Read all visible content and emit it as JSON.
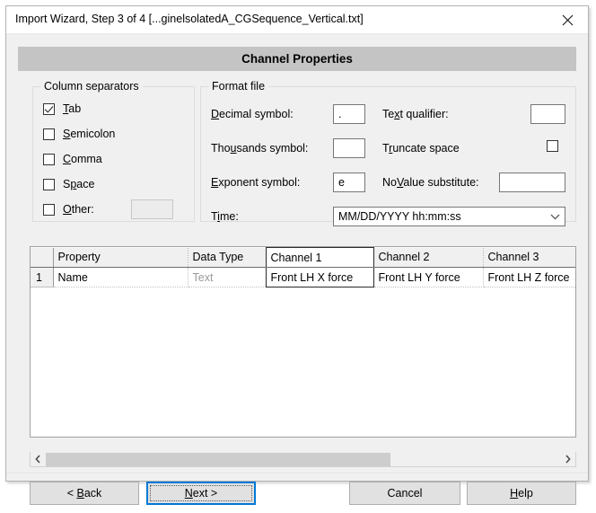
{
  "window": {
    "title": "Import Wizard, Step 3 of 4 [...ginelsolatedA_CGSequence_Vertical.txt]",
    "close_icon": "close-icon"
  },
  "banner": {
    "title": "Channel Properties"
  },
  "column_separators": {
    "group_title": "Column separators",
    "items": [
      {
        "label": "Tab",
        "accel": "T",
        "checked": true
      },
      {
        "label": "Semicolon",
        "accel": "S",
        "checked": false
      },
      {
        "label": "Comma",
        "accel": "C",
        "checked": false
      },
      {
        "label": "Space",
        "accel": "p",
        "checked": false
      },
      {
        "label": "Other:",
        "accel": "O",
        "checked": false
      }
    ],
    "other_value": "",
    "other_enabled": false
  },
  "format_file": {
    "group_title": "Format file",
    "decimal_symbol": {
      "label": "Decimal symbol:",
      "accel": "D",
      "value": "."
    },
    "thousands_symbol": {
      "label": "Thousands symbol:",
      "accel": "u",
      "value": ""
    },
    "exponent_symbol": {
      "label": "Exponent symbol:",
      "accel": "E",
      "value": "e"
    },
    "text_qualifier": {
      "label": "Text qualifier:",
      "accel": "x",
      "value": ""
    },
    "truncate_space": {
      "label": "Truncate space",
      "accel": "r",
      "checked": false
    },
    "novalue_substitute": {
      "label": "NoValue substitute:",
      "accel": "V",
      "value": ""
    },
    "time": {
      "label": "Time:",
      "accel": "i",
      "value": "MM/DD/YYYY hh:mm:ss",
      "arrow_icon": "chevron-down-icon"
    }
  },
  "table": {
    "headers": [
      "",
      "Property",
      "Data Type",
      "Channel 1",
      "Channel 2",
      "Channel 3"
    ],
    "selected_column_index": 3,
    "rows": [
      {
        "number": "1",
        "cells": [
          "Name",
          "Text",
          "Front LH X force",
          "Front LH Y force",
          "Front LH Z force"
        ]
      }
    ]
  },
  "scrollbar": {
    "left_icon": "chevron-left-icon",
    "right_icon": "chevron-right-icon"
  },
  "buttons": {
    "back": {
      "label": "< Back",
      "accel": "B"
    },
    "next": {
      "label": "Next >",
      "accel": "N",
      "default": true
    },
    "cancel": {
      "label": "Cancel"
    },
    "help": {
      "label": "Help",
      "accel": "H"
    }
  },
  "colors": {
    "accent": "#0078d7",
    "banner_bg": "#c4c4c4",
    "dialog_bg": "#f0f0f0"
  }
}
